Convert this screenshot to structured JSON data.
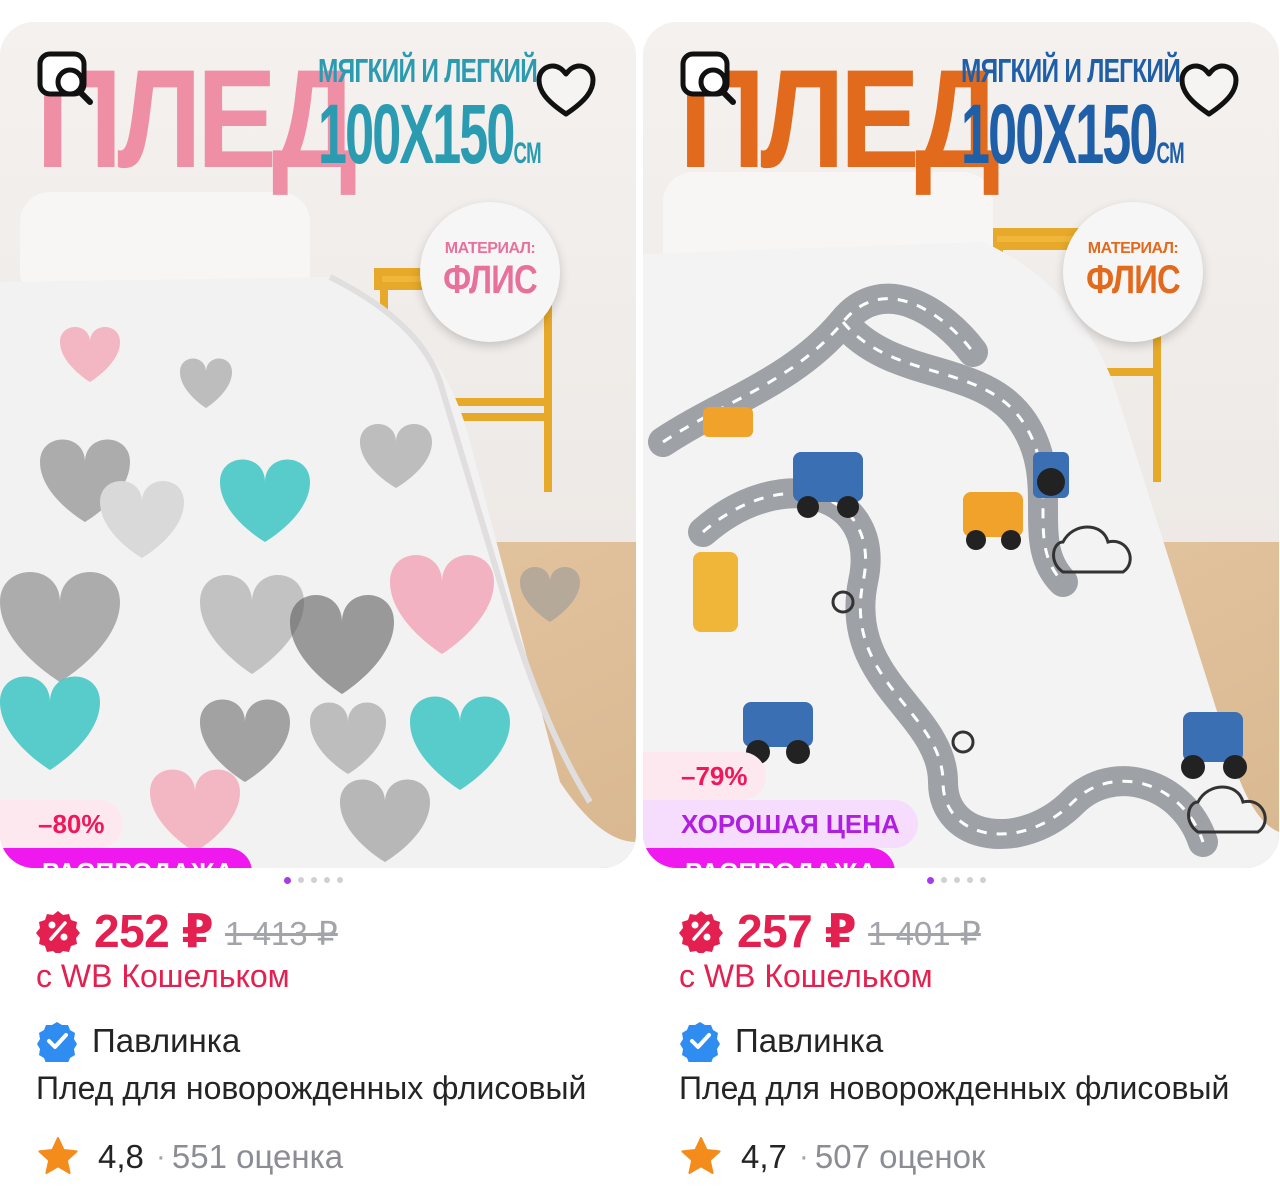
{
  "products": [
    {
      "image": {
        "title_big": "ПЛЕД",
        "subtitle": "МЯГКИЙ И ЛЕГКИЙ",
        "size": "100Х150",
        "size_unit": "СМ",
        "sticker_top": "МАТЕРИАЛ:",
        "sticker_main": "ФЛИС",
        "title_color": "#ef8fa5",
        "sticker_color": "#e8719b",
        "pattern": "hearts",
        "dots_total": 5,
        "dots_active": 1
      },
      "badges": {
        "discount": "–80%",
        "good_price": "",
        "sale": "РАСПРОДАЖА"
      },
      "price": "252 ₽",
      "old_price": "1 413 ₽",
      "wallet_note": "с WB Кошельком",
      "brand": "Павлинка",
      "title": "Плед для новорожденных флисовый",
      "rating": "4,8",
      "separator": "·",
      "reviews": "551 оценка"
    },
    {
      "image": {
        "title_big": "ПЛЕД",
        "subtitle": "МЯГКИЙ И ЛЕГКИЙ",
        "size": "100Х150",
        "size_unit": "СМ",
        "sticker_top": "МАТЕРИАЛ:",
        "sticker_main": "ФЛИС",
        "title_color": "#e26a1c",
        "sticker_color": "#e26a1c",
        "pattern": "roads",
        "dots_total": 5,
        "dots_active": 1
      },
      "badges": {
        "discount": "–79%",
        "good_price": "ХОРОШАЯ ЦЕНА",
        "sale": "РАСПРОДАЖА"
      },
      "price": "257 ₽",
      "old_price": "1 401 ₽",
      "wallet_note": "с WB Кошельком",
      "brand": "Павлинка",
      "title": "Плед для новорожденных флисовый",
      "rating": "4,7",
      "separator": "·",
      "reviews": "507 оценок"
    }
  ],
  "icons": {
    "search_by_image": "image-search-icon",
    "favorite": "heart-outline-icon",
    "wallet": "wallet-discount-icon",
    "verified": "verified-check-icon",
    "rating": "star-icon"
  },
  "colors": {
    "price": "#e3204f",
    "sale_badge": "#ef19ef",
    "good_price_text": "#b01ee0",
    "verified": "#2f8df1",
    "star": "#f48c1c",
    "subtitle": "#2a9bb0",
    "size_text_1": "#2a9bb0",
    "size_text_2": "#1f5fa8"
  }
}
